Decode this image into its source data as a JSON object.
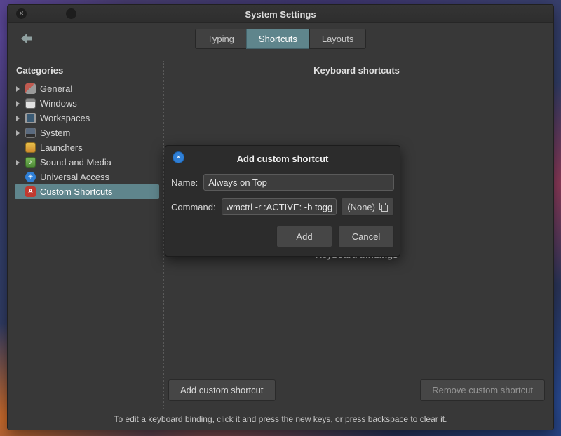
{
  "titlebar": {
    "title": "System Settings"
  },
  "toolbar": {
    "tabs": [
      {
        "label": "Typing",
        "active": false
      },
      {
        "label": "Shortcuts",
        "active": true
      },
      {
        "label": "Layouts",
        "active": false
      }
    ]
  },
  "sidebar": {
    "header": "Categories",
    "items": [
      {
        "label": "General",
        "icon": "general-icon",
        "expandable": true,
        "selected": false
      },
      {
        "label": "Windows",
        "icon": "windows-icon",
        "expandable": true,
        "selected": false
      },
      {
        "label": "Workspaces",
        "icon": "workspaces-icon",
        "expandable": true,
        "selected": false
      },
      {
        "label": "System",
        "icon": "system-icon",
        "expandable": true,
        "selected": false
      },
      {
        "label": "Launchers",
        "icon": "launchers-icon",
        "expandable": false,
        "selected": false
      },
      {
        "label": "Sound and Media",
        "icon": "sound-icon",
        "expandable": true,
        "selected": false
      },
      {
        "label": "Universal Access",
        "icon": "universal-access-icon",
        "expandable": false,
        "selected": false
      },
      {
        "label": "Custom Shortcuts",
        "icon": "custom-shortcuts-icon",
        "expandable": false,
        "selected": true
      }
    ]
  },
  "panel": {
    "shortcuts_header": "Keyboard shortcuts",
    "bindings_header": "Keyboard bindings",
    "add_custom_button": "Add custom shortcut",
    "remove_custom_button": "Remove custom shortcut"
  },
  "dialog": {
    "title": "Add custom shortcut",
    "name_label": "Name:",
    "name_value": "Always on Top",
    "command_label": "Command:",
    "command_value": "wmctrl -r :ACTIVE: -b toggl",
    "none_button": "(None)",
    "add_button": "Add",
    "cancel_button": "Cancel"
  },
  "statusbar": {
    "text": "To edit a keyboard binding, click it and press the new keys, or press backspace to clear it."
  },
  "icons": {
    "close": "✕",
    "dialog_close": "✕",
    "universal_access_glyph": "✳",
    "sound_glyph": "♪",
    "custom_shortcuts_glyph": "A"
  },
  "colors": {
    "accent": "#5f858c",
    "window_bg": "#383838",
    "dialog_bg": "#2c2c2c",
    "dialog_close_blue": "#2f7fd6",
    "custom_icon_red": "#c03a30"
  }
}
